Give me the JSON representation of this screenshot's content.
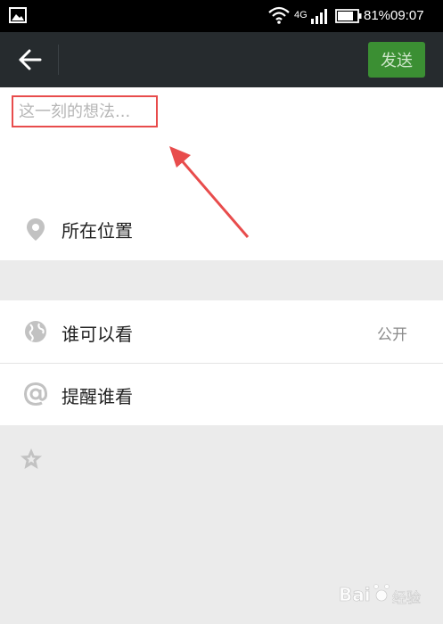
{
  "status_bar": {
    "network": "4G",
    "battery": "81%",
    "time": "09:07",
    "icons": [
      "gallery-icon",
      "wifi-icon",
      "signal-icon",
      "battery-icon"
    ]
  },
  "toolbar": {
    "back_icon": "back-arrow-icon",
    "send_label": "发送",
    "send_color": "#3b8f33"
  },
  "compose": {
    "placeholder": "这一刻的想法...",
    "value": ""
  },
  "location": {
    "icon": "location-pin-icon",
    "label": "所在位置"
  },
  "visibility": {
    "icon": "globe-icon",
    "label": "谁可以看",
    "value": "公开"
  },
  "remind": {
    "icon": "at-icon",
    "label": "提醒谁看"
  },
  "favorite": {
    "icon": "star-icon"
  },
  "annotation": {
    "color": "#e84c4c"
  },
  "watermark": {
    "text": "Bai",
    "sub": "经验"
  }
}
